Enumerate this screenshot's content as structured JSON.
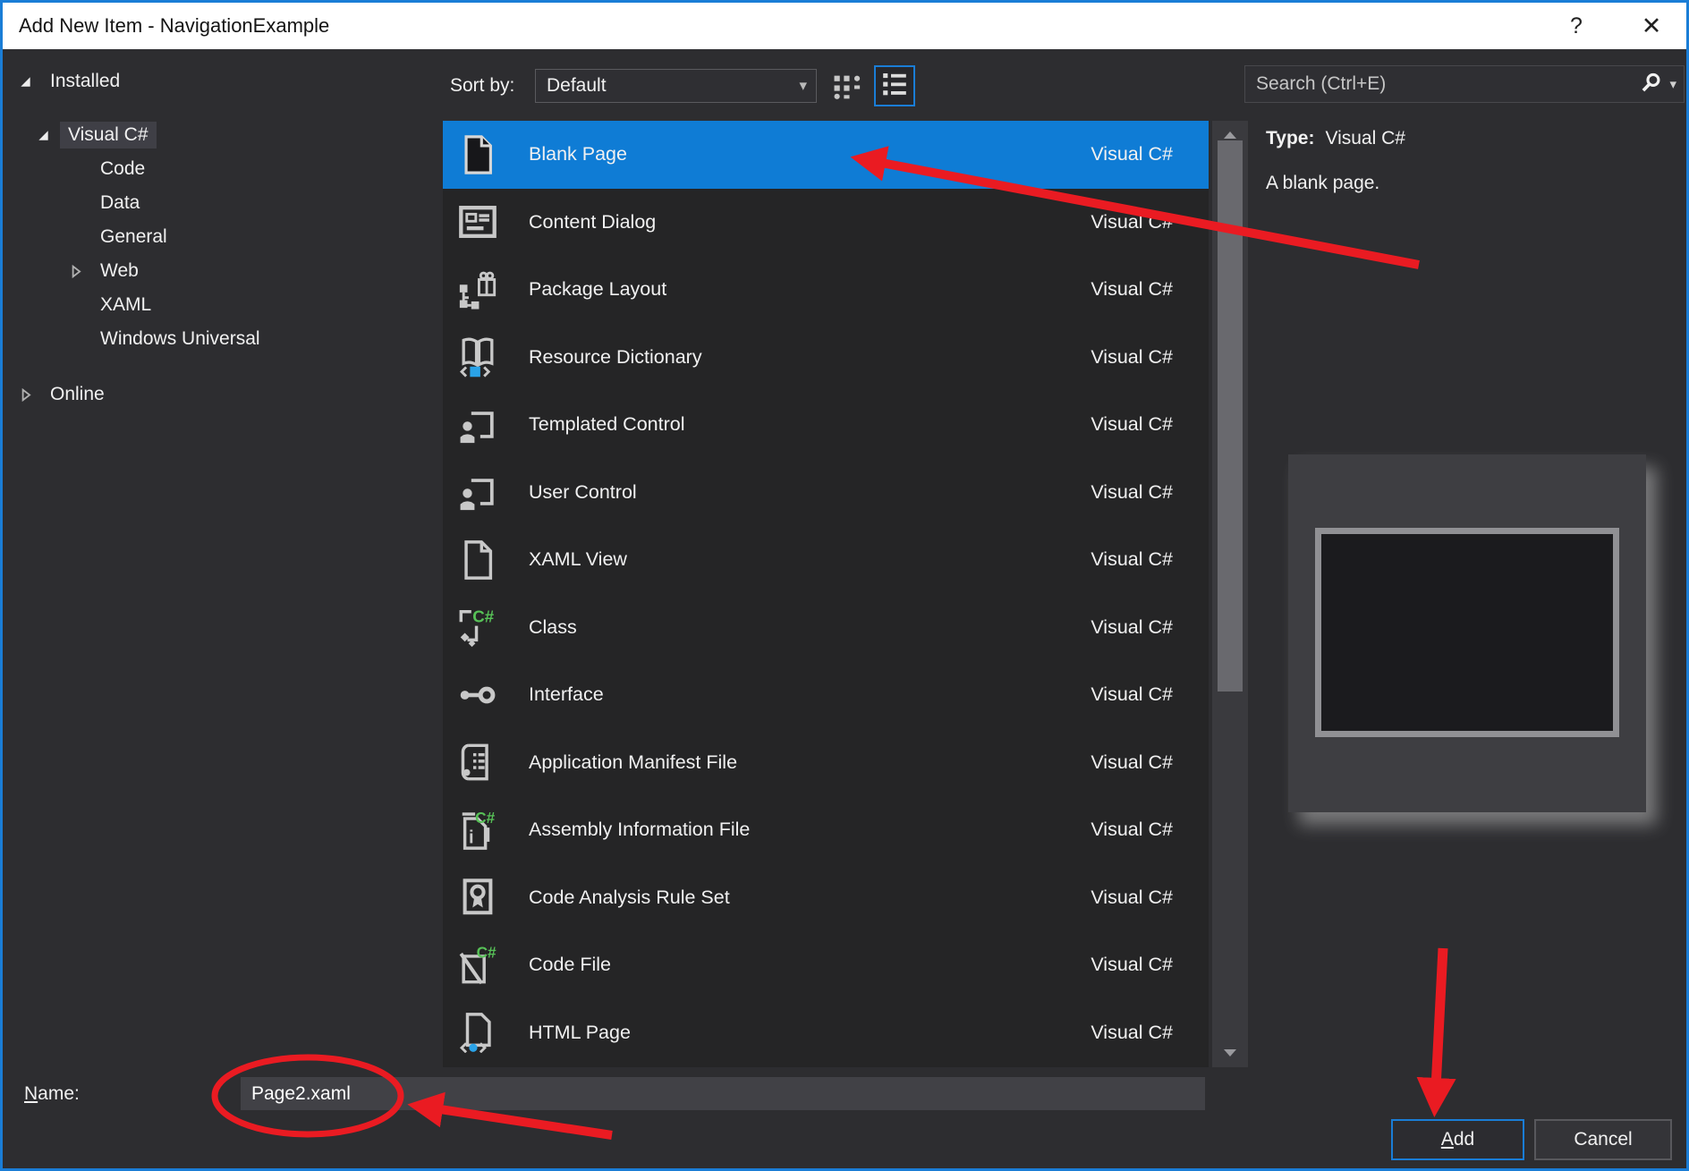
{
  "window": {
    "title": "Add New Item - NavigationExample",
    "help_button": "?",
    "close_button": "✕"
  },
  "left_nav": {
    "items": [
      {
        "label": "Installed",
        "level": 0,
        "expander": "expanded",
        "selected": false
      },
      {
        "label": "Visual C#",
        "level": 1,
        "expander": "expanded",
        "selected": true
      },
      {
        "label": "Code",
        "level": 2,
        "expander": "none",
        "selected": false
      },
      {
        "label": "Data",
        "level": 2,
        "expander": "none",
        "selected": false
      },
      {
        "label": "General",
        "level": 2,
        "expander": "none",
        "selected": false
      },
      {
        "label": "Web",
        "level": 2,
        "expander": "collapsed",
        "selected": false
      },
      {
        "label": "XAML",
        "level": 2,
        "expander": "none",
        "selected": false
      },
      {
        "label": "Windows Universal",
        "level": 2,
        "expander": "none",
        "selected": false
      },
      {
        "label": "Online",
        "level": 0,
        "expander": "collapsed",
        "selected": false
      }
    ]
  },
  "toolbar": {
    "sort_label": "Sort by:",
    "sort_value": "Default"
  },
  "search": {
    "placeholder": "Search (Ctrl+E)"
  },
  "template_list": {
    "items": [
      {
        "name": "Blank Page",
        "type": "Visual C#",
        "icon": "blank-page",
        "selected": true
      },
      {
        "name": "Content Dialog",
        "type": "Visual C#",
        "icon": "content-dialog",
        "selected": false
      },
      {
        "name": "Package Layout",
        "type": "Visual C#",
        "icon": "package-layout",
        "selected": false
      },
      {
        "name": "Resource Dictionary",
        "type": "Visual C#",
        "icon": "resource-dictionary",
        "selected": false
      },
      {
        "name": "Templated Control",
        "type": "Visual C#",
        "icon": "templated-control",
        "selected": false
      },
      {
        "name": "User Control",
        "type": "Visual C#",
        "icon": "user-control",
        "selected": false
      },
      {
        "name": "XAML View",
        "type": "Visual C#",
        "icon": "xaml-view",
        "selected": false
      },
      {
        "name": "Class",
        "type": "Visual C#",
        "icon": "class",
        "selected": false
      },
      {
        "name": "Interface",
        "type": "Visual C#",
        "icon": "interface",
        "selected": false
      },
      {
        "name": "Application Manifest File",
        "type": "Visual C#",
        "icon": "app-manifest",
        "selected": false
      },
      {
        "name": "Assembly Information File",
        "type": "Visual C#",
        "icon": "assembly-info",
        "selected": false
      },
      {
        "name": "Code Analysis Rule Set",
        "type": "Visual C#",
        "icon": "code-analysis",
        "selected": false
      },
      {
        "name": "Code File",
        "type": "Visual C#",
        "icon": "code-file",
        "selected": false
      },
      {
        "name": "HTML Page",
        "type": "Visual C#",
        "icon": "html-page",
        "selected": false
      }
    ]
  },
  "detail": {
    "type_label": "Type:",
    "type_value": "Visual C#",
    "description": "A blank page."
  },
  "footer": {
    "name_label": "Name:",
    "name_value": "Page2.xaml",
    "add_label": "Add",
    "cancel_label": "Cancel"
  },
  "colors": {
    "selection_blue": "#0f7cd5",
    "window_border_blue": "#1a7dd6",
    "annotation_red": "#ea1b22",
    "csharp_green": "#57c157",
    "icon_accent_blue": "#2aa3e8",
    "icon_gray": "#c8c8c8"
  }
}
